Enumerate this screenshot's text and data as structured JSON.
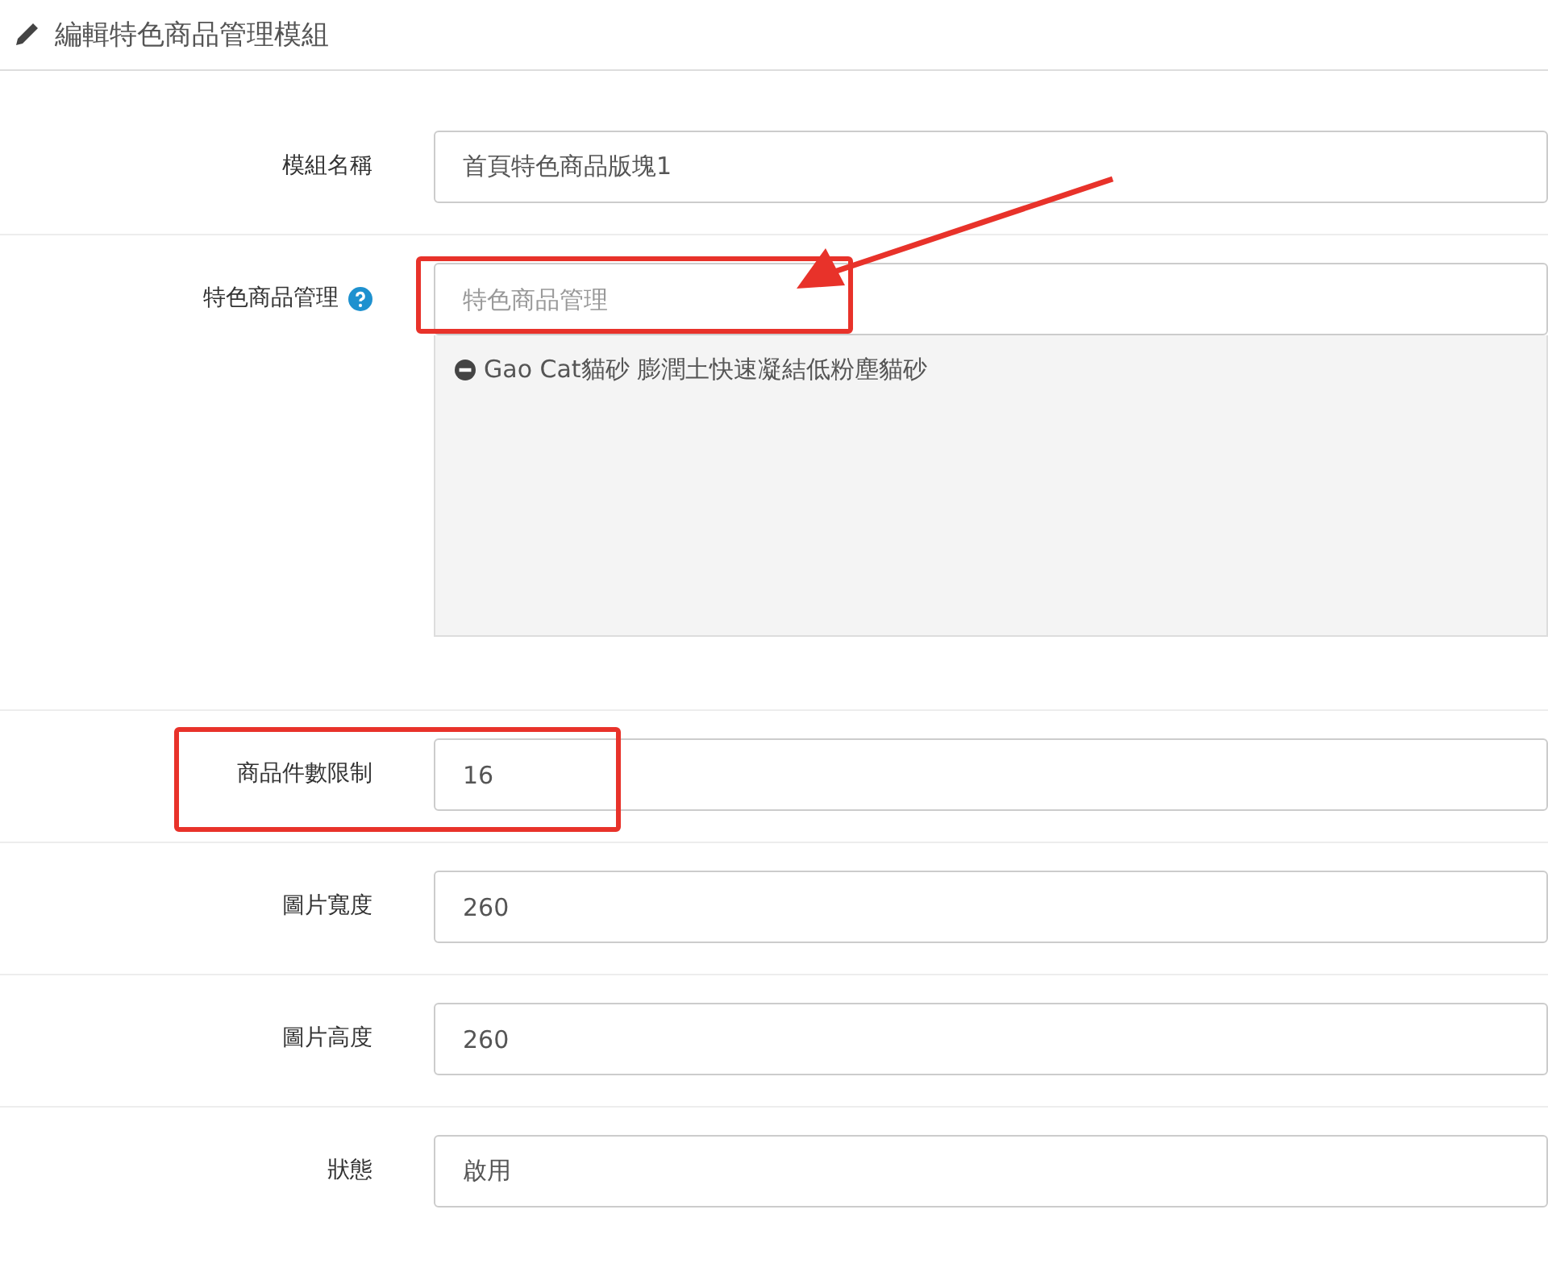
{
  "header": {
    "title": "編輯特色商品管理模組"
  },
  "fields": [
    {
      "kind": "text",
      "label": "模組名稱",
      "value": "首頁特色商品版塊1"
    },
    {
      "kind": "autocomplete",
      "label": "特色商品管理",
      "help": true,
      "placeholder": "特色商品管理",
      "boxed_field": true,
      "arrow": true,
      "items": [
        "Gao Cat貓砂 膨潤土快速凝結低粉塵貓砂"
      ]
    },
    {
      "kind": "text",
      "label": "商品件數限制",
      "value": "16",
      "boxed_row": true
    },
    {
      "kind": "text",
      "label": "圖片寬度",
      "value": "260"
    },
    {
      "kind": "text",
      "label": "圖片高度",
      "value": "260"
    },
    {
      "kind": "select",
      "label": "狀態",
      "value": "啟用"
    }
  ]
}
